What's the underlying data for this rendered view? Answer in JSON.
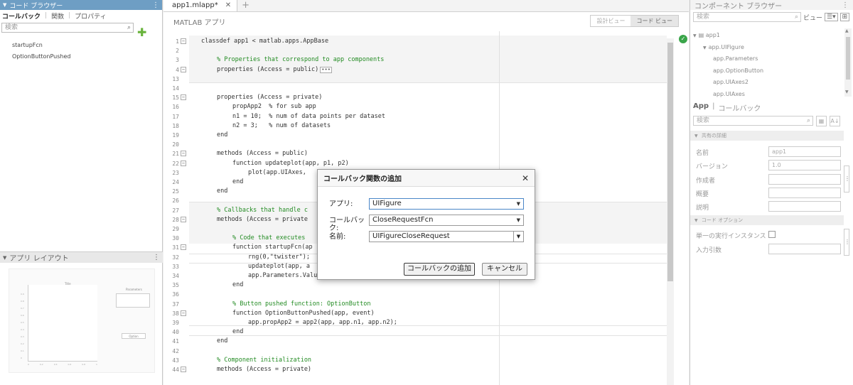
{
  "code_browser": {
    "title": "コード ブラウザー",
    "tabs": [
      "コールバック",
      "関数",
      "プロパティ"
    ],
    "search_placeholder": "検索",
    "items": [
      "startupFcn",
      "OptionButtonPushed"
    ]
  },
  "app_layout": {
    "title": "アプリ レイアウト",
    "preview": {
      "axes_title": "Title",
      "param_label": "Parameters",
      "button_label": "Option",
      "y_ticks": [
        "0.9",
        "0.8",
        "0.7",
        "0.6",
        "0.5",
        "0.4",
        "0.3",
        "0.2",
        "0.1",
        "0"
      ],
      "x_ticks": [
        "0",
        "0.2",
        "0.4",
        "0.6",
        "0.8",
        "1"
      ]
    }
  },
  "editor": {
    "tab_label": "app1.mlapp*",
    "header": "MATLAB アプリ",
    "view_design": "設計ビュー",
    "view_code": "コード ビュー",
    "lines": [
      {
        "n": "1",
        "t": "classdef app1 < matlab.apps.AppBase",
        "c": "kw",
        "i": 0
      },
      {
        "n": "2",
        "t": "",
        "c": "",
        "i": 0
      },
      {
        "n": "3",
        "t": "% Properties that correspond to app components",
        "c": "cm",
        "i": 1
      },
      {
        "n": "4",
        "t": "properties (Access = public)",
        "c": "kw",
        "i": 1,
        "collapsed": "•••"
      },
      {
        "n": "13",
        "t": "",
        "c": "",
        "i": 0
      },
      {
        "n": "14",
        "t": "",
        "c": "",
        "i": 0
      },
      {
        "n": "15",
        "t": "properties (Access = private)",
        "c": "kw",
        "i": 1
      },
      {
        "n": "16",
        "t": "propApp2  % for sub app",
        "c": "kw",
        "i": 2
      },
      {
        "n": "17",
        "t": "n1 = 10;  % num of data points per dataset",
        "c": "kw",
        "i": 2
      },
      {
        "n": "18",
        "t": "n2 = 3;   % num of datasets",
        "c": "kw",
        "i": 2
      },
      {
        "n": "19",
        "t": "end",
        "c": "kw",
        "i": 1
      },
      {
        "n": "20",
        "t": "",
        "c": "",
        "i": 0
      },
      {
        "n": "21",
        "t": "methods (Access = public)",
        "c": "kw",
        "i": 1
      },
      {
        "n": "22",
        "t": "function updateplot(app, p1, p2)",
        "c": "kw",
        "i": 2
      },
      {
        "n": "23",
        "t": "plot(app.UIAxes,",
        "c": "kw",
        "i": 3
      },
      {
        "n": "24",
        "t": "end",
        "c": "kw",
        "i": 2
      },
      {
        "n": "25",
        "t": "end",
        "c": "kw",
        "i": 1
      },
      {
        "n": "26",
        "t": "",
        "c": "",
        "i": 0
      },
      {
        "n": "27",
        "t": "% Callbacks that handle c",
        "c": "cm",
        "i": 1
      },
      {
        "n": "28",
        "t": "methods (Access = private",
        "c": "kw",
        "i": 1
      },
      {
        "n": "29",
        "t": "",
        "c": "",
        "i": 0
      },
      {
        "n": "30",
        "t": "% Code that executes",
        "c": "cm",
        "i": 2
      },
      {
        "n": "31",
        "t": "function startupFcn(ap",
        "c": "kw",
        "i": 2
      },
      {
        "n": "32",
        "t": "rng(0,\"twister\");",
        "c": "kw",
        "i": 3
      },
      {
        "n": "33",
        "t": "updateplot(app, a",
        "c": "kw",
        "i": 3
      },
      {
        "n": "34",
        "t": "app.Parameters.Value = string(app.n1) + \", \" + string(app.n2);",
        "c": "kw",
        "i": 3
      },
      {
        "n": "35",
        "t": "end",
        "c": "kw",
        "i": 2
      },
      {
        "n": "36",
        "t": "",
        "c": "",
        "i": 0
      },
      {
        "n": "37",
        "t": "% Button pushed function: OptionButton",
        "c": "cm",
        "i": 2
      },
      {
        "n": "38",
        "t": "function OptionButtonPushed(app, event)",
        "c": "kw",
        "i": 2
      },
      {
        "n": "39",
        "t": "app.propApp2 = app2(app, app.n1, app.n2);",
        "c": "kw",
        "i": 3
      },
      {
        "n": "40",
        "t": "end",
        "c": "kw",
        "i": 2
      },
      {
        "n": "41",
        "t": "end",
        "c": "kw",
        "i": 1
      },
      {
        "n": "42",
        "t": "",
        "c": "",
        "i": 0
      },
      {
        "n": "43",
        "t": "% Component initialization",
        "c": "cm",
        "i": 1
      },
      {
        "n": "44",
        "t": "methods (Access = private)",
        "c": "kw",
        "i": 1
      }
    ]
  },
  "dialog": {
    "title": "コールバック関数の追加",
    "app_label": "アプリ:",
    "app_value": "UIFigure",
    "callback_label": "コールバック:",
    "callback_value": "CloseRequestFcn",
    "name_label": "名前:",
    "name_value": "UIFigureCloseRequest",
    "add_button": "コールバックの追加",
    "cancel_button": "キャンセル"
  },
  "component_browser": {
    "title": "コンポーネント ブラウザー",
    "search_placeholder": "検索",
    "view_label": "ビュー",
    "tree": [
      {
        "label": "app1",
        "level": 0,
        "expanded": true
      },
      {
        "label": "app.UIFigure",
        "level": 1,
        "expanded": true
      },
      {
        "label": "app.Parameters",
        "level": 2
      },
      {
        "label": "app.OptionButton",
        "level": 2
      },
      {
        "label": "app.UIAxes2",
        "level": 2
      },
      {
        "label": "app.UIAxes",
        "level": 2
      }
    ],
    "inspector_tabs": [
      "App",
      "コールバック"
    ],
    "inspector_search": "検索",
    "group_shared": "共有の詳細",
    "props": [
      {
        "label": "名前",
        "value": "app1"
      },
      {
        "label": "バージョン",
        "value": "1.0"
      },
      {
        "label": "作成者",
        "value": ""
      },
      {
        "label": "概要",
        "value": ""
      },
      {
        "label": "説明",
        "value": ""
      }
    ],
    "group_code": "コード オプション",
    "single_instance_label": "単一の実行インスタンス",
    "input_args_label": "入力引数"
  }
}
